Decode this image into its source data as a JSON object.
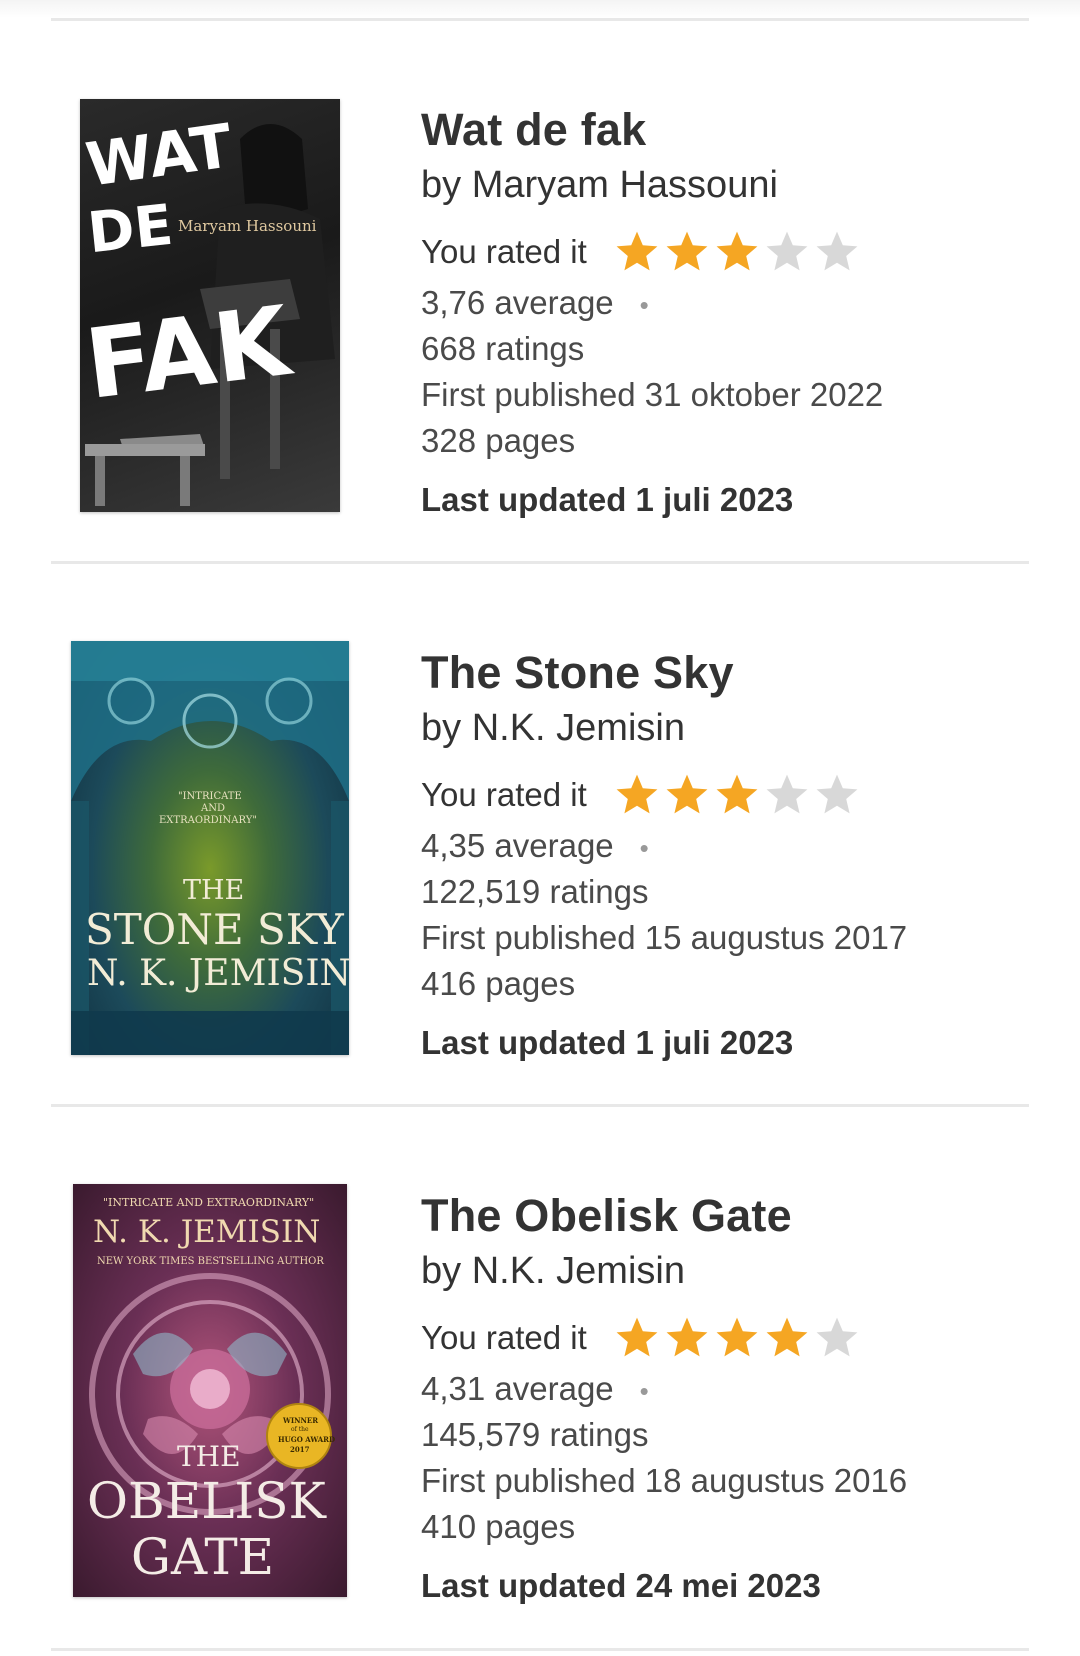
{
  "books": [
    {
      "title": "Wat de fak",
      "author": "by Maryam Hassouni",
      "rated_label": "You rated it",
      "user_rating": 3,
      "max_rating": 5,
      "average": "3,76 average",
      "ratings": "668 ratings",
      "first_published": "First published 31 oktober 2022",
      "pages": "328 pages",
      "last_updated": "Last updated 1 juli 2023",
      "cover": {
        "line1": "WAT",
        "line2": "DE",
        "line3": "FAK",
        "author": "Maryam Hassouni"
      }
    },
    {
      "title": "The Stone Sky",
      "author": "by N.K. Jemisin",
      "rated_label": "You rated it",
      "user_rating": 3,
      "max_rating": 5,
      "average": "4,35 average",
      "ratings": "122,519 ratings",
      "first_published": "First published 15 augustus 2017",
      "pages": "416 pages",
      "last_updated": "Last updated 1 juli 2023",
      "cover": {
        "quote1": "\"INTRICATE",
        "quote2": "AND",
        "quote3": "EXTRAORDINARY\"",
        "line1": "THE",
        "line2": "STONE SKY",
        "author": "N. K. JEMISIN"
      }
    },
    {
      "title": "The Obelisk Gate",
      "author": "by N.K. Jemisin",
      "rated_label": "You rated it",
      "user_rating": 4,
      "max_rating": 5,
      "average": "4,31 average",
      "ratings": "145,579 ratings",
      "first_published": "First published 18 augustus 2016",
      "pages": "410 pages",
      "last_updated": "Last updated 24 mei 2023",
      "cover": {
        "quote": "\"INTRICATE AND EXTRAORDINARY\"",
        "author": "N. K. JEMISIN",
        "tagline": "NEW YORK TIMES BESTSELLING AUTHOR",
        "line1": "THE",
        "line2": "OBELISK",
        "line3": "GATE",
        "badge1": "WINNER",
        "badge2": "of the",
        "badge3": "HUGO AWARD",
        "badge4": "2017"
      }
    }
  ],
  "colors": {
    "star_filled": "#F5A623",
    "star_empty": "#D8D8D8",
    "divider": "#E8E8E8"
  }
}
